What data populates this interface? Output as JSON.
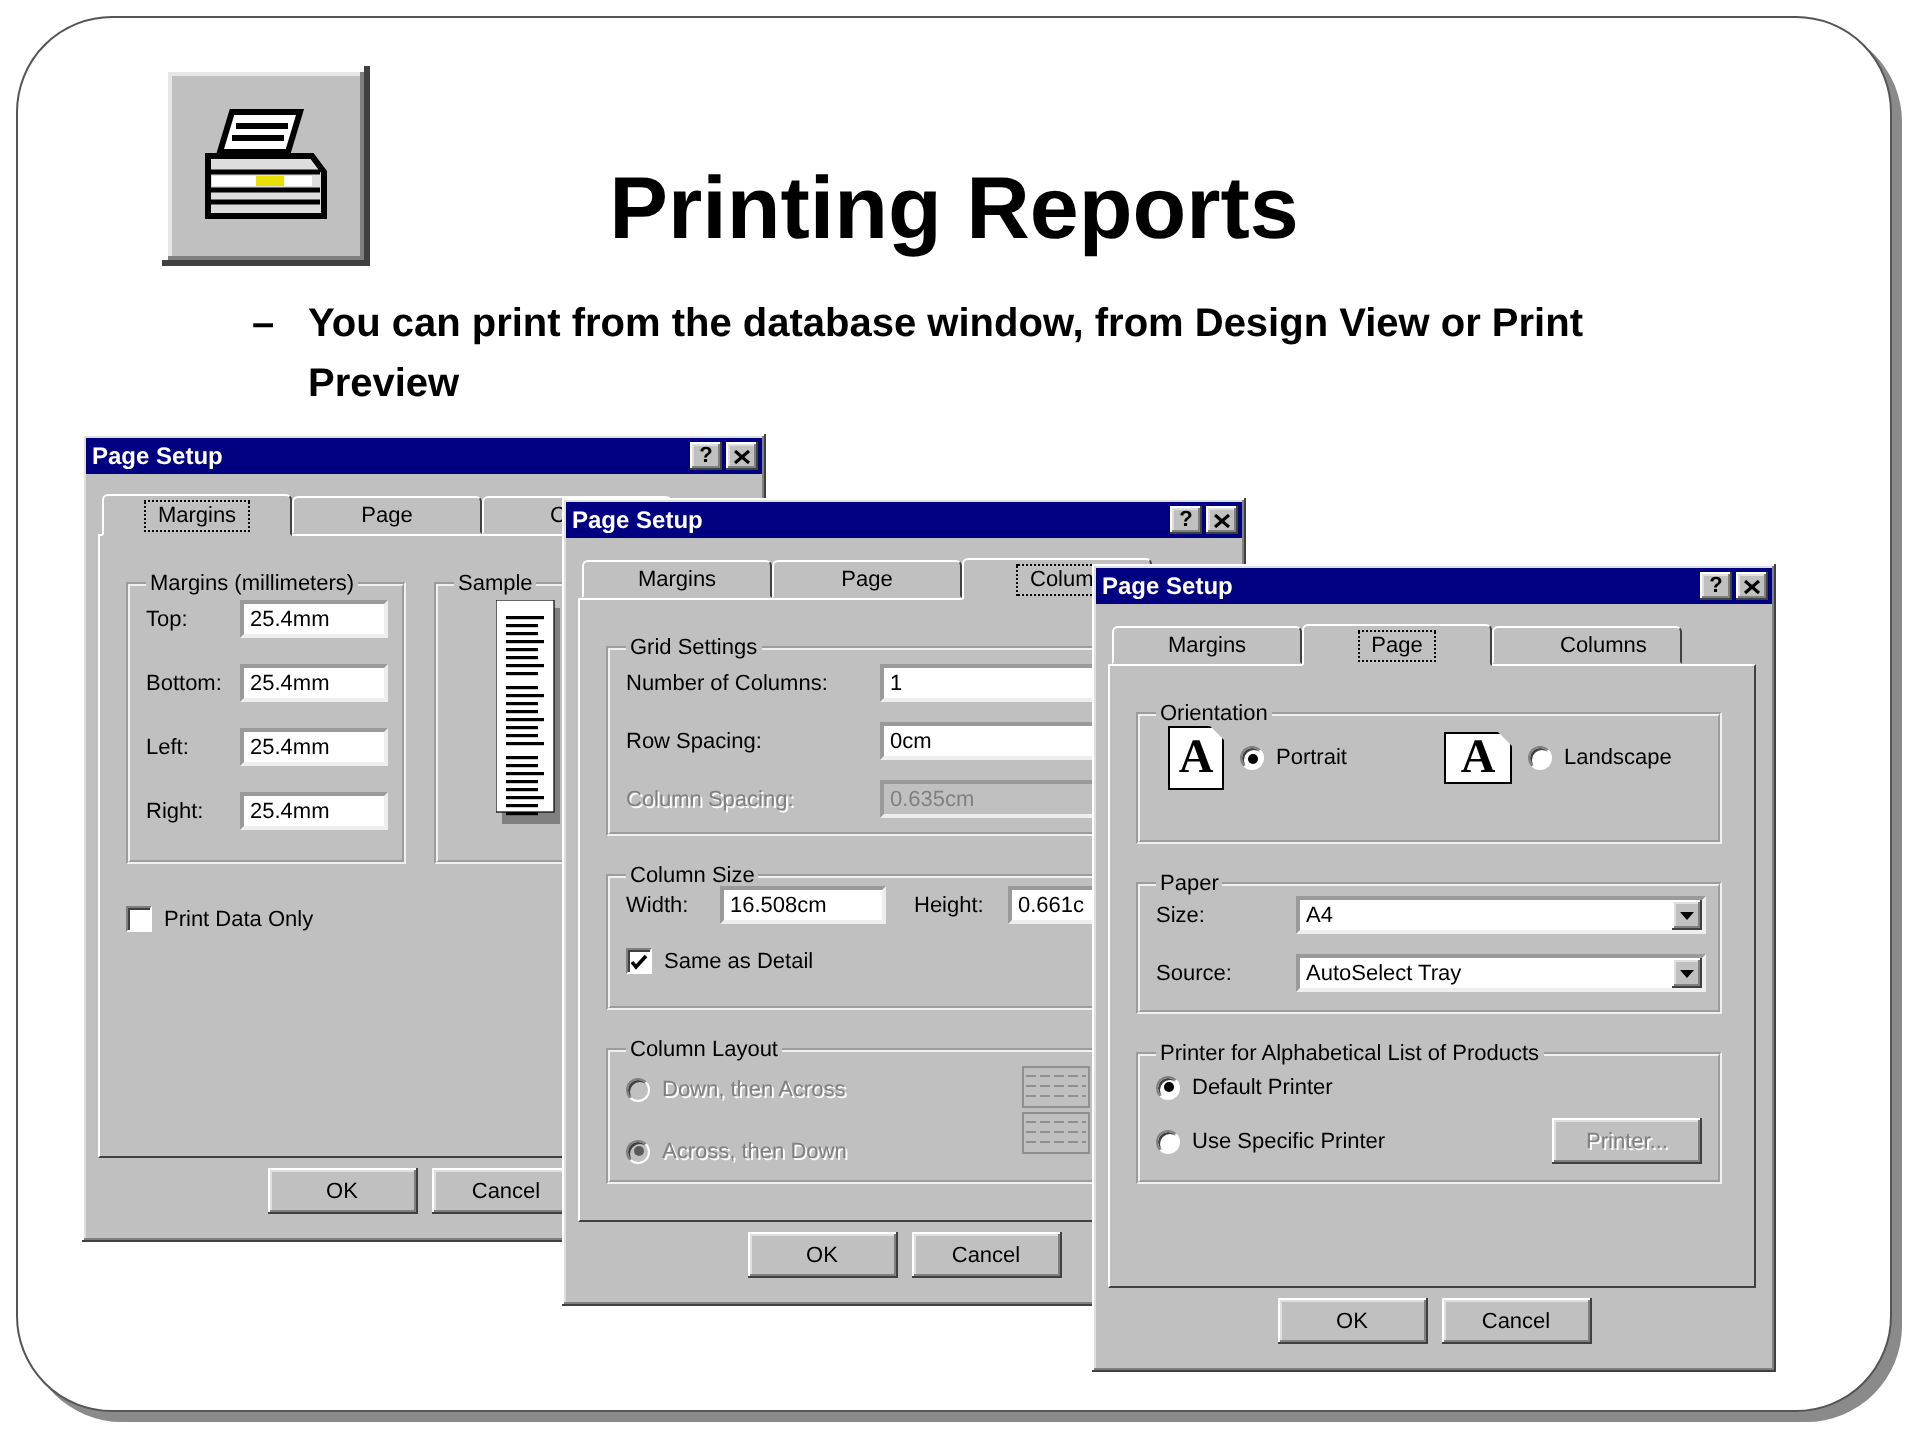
{
  "slide": {
    "title": "Printing Reports",
    "bullet_marker": "–",
    "bullet": "You can print from the database window, from Design View or Print Preview"
  },
  "dialogs": [
    {
      "kind": "margins",
      "title": "Page Setup",
      "help": "?",
      "tabs": [
        {
          "label": "Margins",
          "selected": true
        },
        {
          "label": "Page",
          "selected": false
        },
        {
          "label": "C",
          "selected": false
        }
      ],
      "margins_group": {
        "legend": "Margins (millimeters)",
        "fields": [
          {
            "label": "Top:",
            "value": "25.4mm"
          },
          {
            "label": "Bottom:",
            "value": "25.4mm"
          },
          {
            "label": "Left:",
            "value": "25.4mm"
          },
          {
            "label": "Right:",
            "value": "25.4mm"
          }
        ]
      },
      "sample_group": {
        "legend": "Sample"
      },
      "print_data_only": {
        "label": "Print Data Only",
        "checked": false
      },
      "buttons": [
        "OK",
        "Cancel"
      ]
    },
    {
      "kind": "columns",
      "title": "Page Setup",
      "help": "?",
      "tabs": [
        {
          "label": "Margins",
          "selected": false
        },
        {
          "label": "Page",
          "selected": false
        },
        {
          "label": "Colum",
          "selected": true
        }
      ],
      "grid_group": {
        "legend": "Grid Settings",
        "fields": [
          {
            "label": "Number of Columns:",
            "value": "1",
            "disabled": false
          },
          {
            "label": "Row Spacing:",
            "value": "0cm",
            "disabled": false
          },
          {
            "label": "Column Spacing:",
            "value": "0.635cm",
            "disabled": true
          }
        ]
      },
      "size_group": {
        "legend": "Column Size",
        "width_label": "Width:",
        "width_value": "16.508cm",
        "height_label": "Height:",
        "height_value": "0.661c",
        "same_as_detail": {
          "label": "Same as Detail",
          "checked": true
        }
      },
      "layout_group": {
        "legend": "Column Layout",
        "disabled": true,
        "options": [
          {
            "label": "Down, then Across",
            "selected": false
          },
          {
            "label": "Across, then Down",
            "selected": true
          }
        ]
      },
      "buttons": [
        "OK",
        "Cancel"
      ]
    },
    {
      "kind": "page",
      "title": "Page Setup",
      "help": "?",
      "tabs": [
        {
          "label": "Margins",
          "selected": false
        },
        {
          "label": "Page",
          "selected": true
        },
        {
          "label": "Columns",
          "selected": false
        }
      ],
      "orientation_group": {
        "legend": "Orientation",
        "options": [
          {
            "kind": "portrait",
            "icon_letter": "A",
            "label": "Portrait",
            "selected": true
          },
          {
            "kind": "landscape",
            "icon_letter": "A",
            "label": "Landscape",
            "selected": false
          }
        ]
      },
      "paper_group": {
        "legend": "Paper",
        "fields": [
          {
            "label": "Size:",
            "value": "A4"
          },
          {
            "label": "Source:",
            "value": "AutoSelect Tray"
          }
        ]
      },
      "printer_group": {
        "legend": "Printer for Alphabetical List of Products",
        "options": [
          {
            "label": "Default Printer",
            "selected": true
          },
          {
            "label": "Use Specific Printer",
            "selected": false
          }
        ],
        "printer_button": {
          "label": "Printer...",
          "disabled": true
        }
      },
      "buttons": [
        "OK",
        "Cancel"
      ]
    }
  ]
}
